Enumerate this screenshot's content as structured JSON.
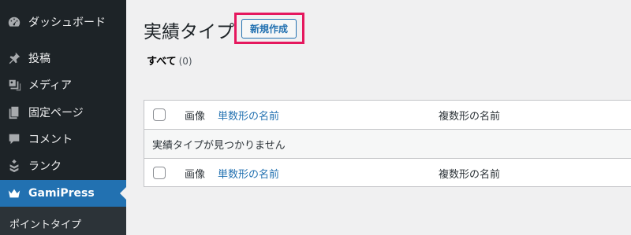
{
  "sidebar": {
    "items": [
      {
        "label": "ダッシュボード",
        "icon": "dashboard-icon"
      },
      {
        "label": "投稿",
        "icon": "pin-icon"
      },
      {
        "label": "メディア",
        "icon": "media-icon"
      },
      {
        "label": "固定ページ",
        "icon": "pages-icon"
      },
      {
        "label": "コメント",
        "icon": "comment-icon"
      },
      {
        "label": "ランク",
        "icon": "rank-icon"
      },
      {
        "label": "GamiPress",
        "icon": "crown-icon"
      }
    ],
    "submenu": {
      "label": "ポイントタイプ"
    }
  },
  "header": {
    "title": "実績タイプ",
    "add_new_label": "新規作成"
  },
  "filters": {
    "all_label": "すべて",
    "all_count": "(0)"
  },
  "table": {
    "columns": {
      "image": "画像",
      "singular": "単数形の名前",
      "plural": "複数形の名前"
    },
    "empty_message": "実績タイプが見つかりません"
  },
  "colors": {
    "sidebar_bg": "#1d2327",
    "active_bg": "#2271b1",
    "highlight": "#e5185e",
    "link": "#2271b1"
  }
}
